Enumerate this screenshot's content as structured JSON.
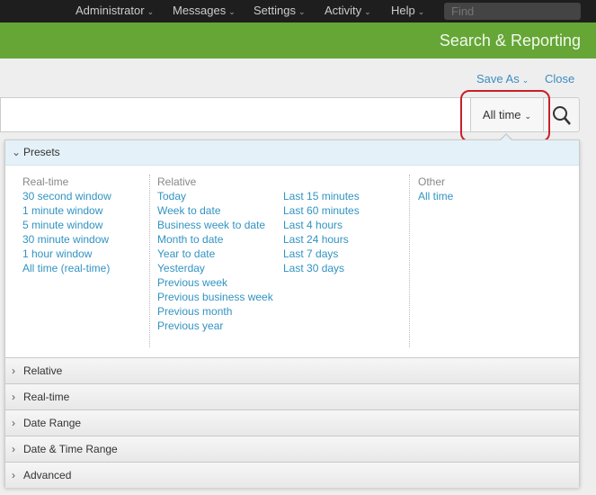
{
  "topbar": {
    "menus": [
      "Administrator",
      "Messages",
      "Settings",
      "Activity",
      "Help"
    ],
    "find_placeholder": "Find"
  },
  "app": {
    "title": "Search & Reporting"
  },
  "actions": {
    "save_as": "Save As",
    "close": "Close"
  },
  "search": {
    "value": "",
    "time_range": "All time"
  },
  "colors": {
    "topbar": "#1e1e1e",
    "appbar": "#65a637",
    "link": "#3293c2",
    "highlight": "#c8202a"
  },
  "dropdown": {
    "presets_label": "Presets",
    "realtime": {
      "heading": "Real-time",
      "items": [
        "30 second window",
        "1 minute window",
        "5 minute window",
        "30 minute window",
        "1 hour window",
        "All time (real-time)"
      ]
    },
    "relative": {
      "heading": "Relative",
      "items": [
        "Today",
        "Week to date",
        "Business week to date",
        "Month to date",
        "Year to date",
        "Yesterday",
        "Previous week",
        "Previous business week",
        "Previous month",
        "Previous year"
      ],
      "items2": [
        "Last 15 minutes",
        "Last 60 minutes",
        "Last 4 hours",
        "Last 24 hours",
        "Last 7 days",
        "Last 30 days"
      ]
    },
    "other": {
      "heading": "Other",
      "items": [
        "All time"
      ]
    },
    "sections": [
      "Relative",
      "Real-time",
      "Date Range",
      "Date & Time Range",
      "Advanced"
    ]
  }
}
